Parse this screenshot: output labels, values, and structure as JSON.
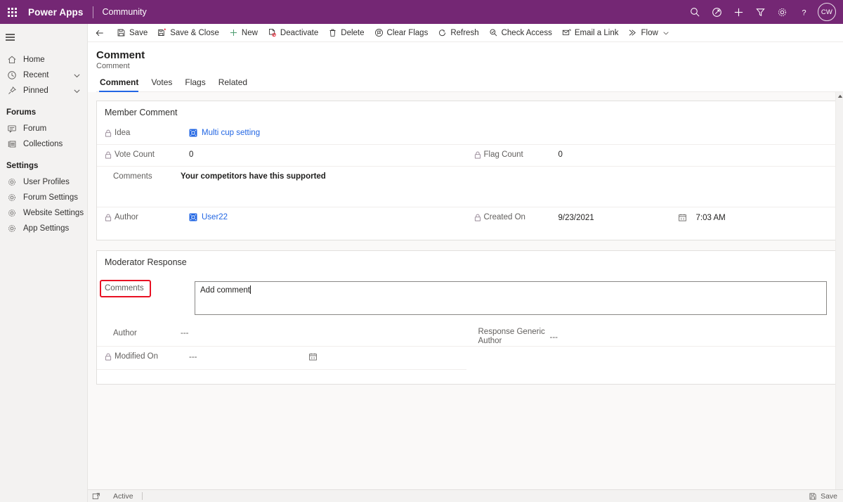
{
  "suitebar": {
    "waffle_label": "app-launcher",
    "brand": "Power Apps",
    "app_name": "Community",
    "icons": [
      "search-icon",
      "diagnostics-icon",
      "plus-icon",
      "filter-icon",
      "settings-gear-icon",
      "help-icon"
    ],
    "avatar_initials": "CW",
    "background_color": "#742774"
  },
  "sidebar": {
    "items": [
      {
        "label": "Home",
        "icon": "home-icon"
      },
      {
        "label": "Recent",
        "icon": "clock-icon",
        "chevron": true
      },
      {
        "label": "Pinned",
        "icon": "pin-icon",
        "chevron": true
      }
    ],
    "groups": [
      {
        "title": "Forums",
        "items": [
          {
            "label": "Forum",
            "icon": "forum-icon"
          },
          {
            "label": "Collections",
            "icon": "collections-icon"
          }
        ]
      },
      {
        "title": "Settings",
        "items": [
          {
            "label": "User Profiles",
            "icon": "gear-icon"
          },
          {
            "label": "Forum Settings",
            "icon": "gear-icon"
          },
          {
            "label": "Website Settings",
            "icon": "gear-icon"
          },
          {
            "label": "App Settings",
            "icon": "gear-icon"
          }
        ]
      }
    ]
  },
  "commandbar": {
    "back": "back-arrow-icon",
    "buttons": [
      {
        "label": "Save",
        "icon": "save-icon"
      },
      {
        "label": "Save & Close",
        "icon": "save-close-icon"
      },
      {
        "label": "New",
        "icon": "plus-icon"
      },
      {
        "label": "Deactivate",
        "icon": "deactivate-icon"
      },
      {
        "label": "Delete",
        "icon": "trash-icon"
      },
      {
        "label": "Clear Flags",
        "icon": "clear-flags-icon"
      },
      {
        "label": "Refresh",
        "icon": "refresh-icon"
      },
      {
        "label": "Check Access",
        "icon": "check-access-icon"
      },
      {
        "label": "Email a Link",
        "icon": "email-link-icon"
      },
      {
        "label": "Flow",
        "icon": "flow-icon",
        "caret": true
      }
    ]
  },
  "form": {
    "title": "Comment",
    "subtitle": "Comment",
    "tabs": [
      {
        "label": "Comment",
        "active": true
      },
      {
        "label": "Votes",
        "active": false
      },
      {
        "label": "Flags",
        "active": false
      },
      {
        "label": "Related",
        "active": false
      }
    ]
  },
  "member_comment": {
    "section_title": "Member Comment",
    "idea": {
      "label": "Idea",
      "value": "Multi cup setting",
      "locked": true,
      "is_link": true
    },
    "vote_count": {
      "label": "Vote Count",
      "value": "0",
      "locked": true
    },
    "flag_count": {
      "label": "Flag Count",
      "value": "0",
      "locked": true
    },
    "comments": {
      "label": "Comments",
      "value": "Your competitors have this supported",
      "locked": false
    },
    "author": {
      "label": "Author",
      "value": "User22",
      "locked": true,
      "is_link": true
    },
    "created_on": {
      "label": "Created On",
      "date": "9/23/2021",
      "time": "7:03 AM",
      "locked": true
    }
  },
  "moderator_response": {
    "section_title": "Moderator Response",
    "comments": {
      "label": "Comments",
      "value": "Add comment",
      "highlighted": true
    },
    "author": {
      "label": "Author",
      "value": "---",
      "locked": false
    },
    "response_generic_author": {
      "label": "Response Generic Author",
      "value": "---",
      "locked": false
    },
    "modified_on": {
      "label": "Modified On",
      "value": "---",
      "locked": true
    }
  },
  "footer": {
    "open_icon": "open-form-icon",
    "status": "Active",
    "save_label": "Save",
    "save_icon": "save-icon"
  },
  "colors": {
    "brand_purple": "#742774",
    "tab_accent": "#2266e3",
    "link_blue": "#2266e3",
    "highlight_red": "#e81123"
  }
}
